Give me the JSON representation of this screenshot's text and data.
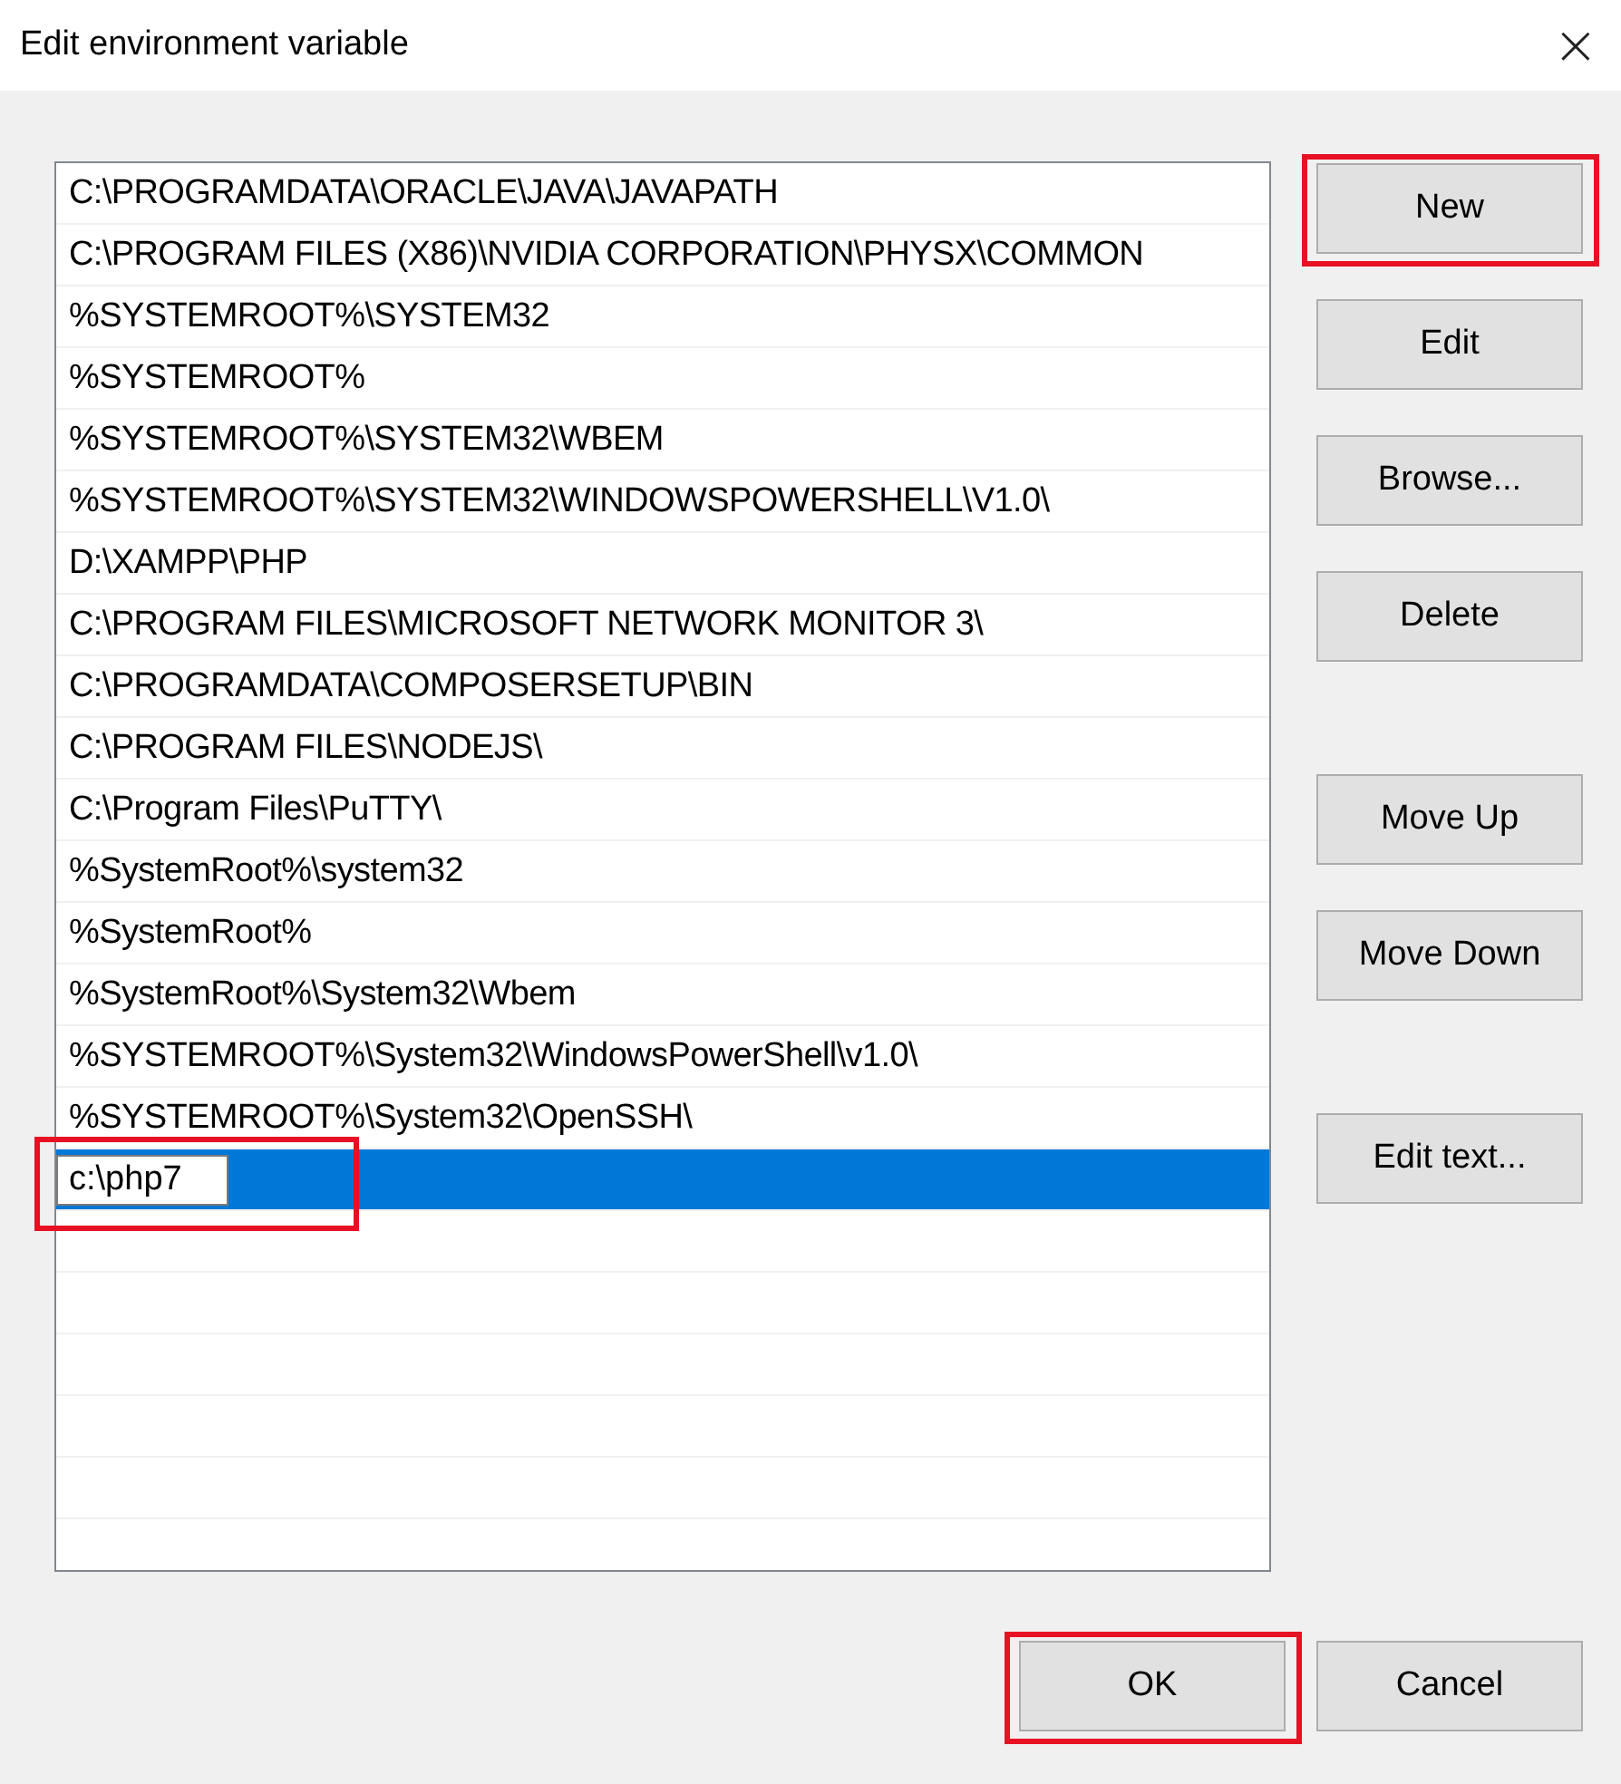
{
  "window": {
    "title": "Edit environment variable",
    "close": "×"
  },
  "list": {
    "rows": [
      {
        "text": "C:\\PROGRAMDATA\\ORACLE\\JAVA\\JAVAPATH",
        "selected": false,
        "editing": false
      },
      {
        "text": "C:\\PROGRAM FILES (X86)\\NVIDIA CORPORATION\\PHYSX\\COMMON",
        "selected": false,
        "editing": false
      },
      {
        "text": "%SYSTEMROOT%\\SYSTEM32",
        "selected": false,
        "editing": false
      },
      {
        "text": "%SYSTEMROOT%",
        "selected": false,
        "editing": false
      },
      {
        "text": "%SYSTEMROOT%\\SYSTEM32\\WBEM",
        "selected": false,
        "editing": false
      },
      {
        "text": "%SYSTEMROOT%\\SYSTEM32\\WINDOWSPOWERSHELL\\V1.0\\",
        "selected": false,
        "editing": false
      },
      {
        "text": "D:\\XAMPP\\PHP",
        "selected": false,
        "editing": false
      },
      {
        "text": "C:\\PROGRAM FILES\\MICROSOFT NETWORK MONITOR 3\\",
        "selected": false,
        "editing": false
      },
      {
        "text": "C:\\PROGRAMDATA\\COMPOSERSETUP\\BIN",
        "selected": false,
        "editing": false
      },
      {
        "text": "C:\\PROGRAM FILES\\NODEJS\\",
        "selected": false,
        "editing": false
      },
      {
        "text": "C:\\Program Files\\PuTTY\\",
        "selected": false,
        "editing": false
      },
      {
        "text": "%SystemRoot%\\system32",
        "selected": false,
        "editing": false
      },
      {
        "text": "%SystemRoot%",
        "selected": false,
        "editing": false
      },
      {
        "text": "%SystemRoot%\\System32\\Wbem",
        "selected": false,
        "editing": false
      },
      {
        "text": "%SYSTEMROOT%\\System32\\WindowsPowerShell\\v1.0\\",
        "selected": false,
        "editing": false
      },
      {
        "text": "%SYSTEMROOT%\\System32\\OpenSSH\\",
        "selected": false,
        "editing": false
      },
      {
        "text": "c:\\php7",
        "selected": true,
        "editing": true,
        "highlighted": true
      }
    ]
  },
  "side_buttons": [
    [
      {
        "label": "New",
        "highlighted": true
      },
      {
        "label": "Edit",
        "highlighted": false
      },
      {
        "label": "Browse...",
        "highlighted": false
      },
      {
        "label": "Delete",
        "highlighted": false
      }
    ],
    [
      {
        "label": "Move Up",
        "highlighted": false
      },
      {
        "label": "Move Down",
        "highlighted": false
      }
    ],
    [
      {
        "label": "Edit text...",
        "highlighted": false
      }
    ]
  ],
  "footer_buttons": [
    {
      "label": "OK",
      "highlighted": true
    },
    {
      "label": "Cancel",
      "highlighted": false
    }
  ]
}
